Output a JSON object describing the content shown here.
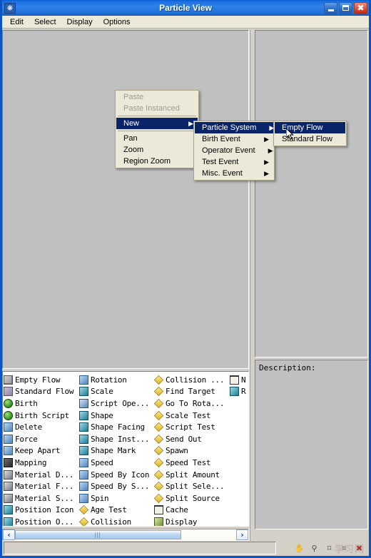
{
  "window": {
    "title": "Particle View",
    "sysicon": "particle-view-icon",
    "buttons": {
      "minimize": "Minimize",
      "maximize": "Maximize",
      "close": "Close"
    }
  },
  "menubar": {
    "items": [
      "Edit",
      "Select",
      "Display",
      "Options"
    ]
  },
  "context_menu": {
    "main": [
      {
        "label": "Paste",
        "disabled": true,
        "submenu": false,
        "selected": false
      },
      {
        "label": "Paste Instanced",
        "disabled": true,
        "submenu": false,
        "selected": false
      },
      {
        "label": "New",
        "disabled": false,
        "submenu": true,
        "selected": true
      },
      {
        "label": "Pan",
        "disabled": false,
        "submenu": false,
        "selected": false
      },
      {
        "label": "Zoom",
        "disabled": false,
        "submenu": false,
        "selected": false
      },
      {
        "label": "Region Zoom",
        "disabled": false,
        "submenu": false,
        "selected": false
      }
    ],
    "new_submenu": [
      {
        "label": "Particle System",
        "submenu": true,
        "selected": true
      },
      {
        "label": "Birth Event",
        "submenu": true,
        "selected": false
      },
      {
        "label": "Operator Event",
        "submenu": true,
        "selected": false
      },
      {
        "label": "Test Event",
        "submenu": true,
        "selected": false
      },
      {
        "label": "Misc. Event",
        "submenu": true,
        "selected": false
      }
    ],
    "particle_system_submenu": [
      {
        "label": "Empty Flow",
        "submenu": false,
        "selected": true
      },
      {
        "label": "Standard Flow",
        "submenu": false,
        "selected": false
      }
    ],
    "arrow_glyph": "▶"
  },
  "depot": {
    "columns": [
      {
        "items": [
          {
            "label": "Empty Flow",
            "icon": "empty-flow-icon",
            "style": "flow"
          },
          {
            "label": "Standard Flow",
            "icon": "standard-flow-icon",
            "style": "flow2"
          },
          {
            "label": "Birth",
            "icon": "birth-icon",
            "style": "green"
          },
          {
            "label": "Birth Script",
            "icon": "birth-script-icon",
            "style": "green"
          },
          {
            "label": "Delete",
            "icon": "delete-icon",
            "style": "blue"
          },
          {
            "label": "Force",
            "icon": "force-icon",
            "style": "blue"
          },
          {
            "label": "Keep Apart",
            "icon": "keep-apart-icon",
            "style": "blue"
          },
          {
            "label": "Mapping",
            "icon": "mapping-icon",
            "style": "dark"
          },
          {
            "label": "Material D...",
            "icon": "material-dynamic-icon",
            "style": "mat"
          },
          {
            "label": "Material F...",
            "icon": "material-frequency-icon",
            "style": "mat"
          },
          {
            "label": "Material S...",
            "icon": "material-static-icon",
            "style": "mat"
          },
          {
            "label": "Position Icon",
            "icon": "position-icon",
            "style": "teal"
          },
          {
            "label": "Position O...",
            "icon": "position-object-icon",
            "style": "teal"
          }
        ]
      },
      {
        "items": [
          {
            "label": "Rotation",
            "icon": "rotation-icon",
            "style": "blue"
          },
          {
            "label": "Scale",
            "icon": "scale-icon",
            "style": "teal"
          },
          {
            "label": "Script Ope...",
            "icon": "script-operator-icon",
            "style": "sq-s"
          },
          {
            "label": "Shape",
            "icon": "shape-icon",
            "style": "teal"
          },
          {
            "label": "Shape Facing",
            "icon": "shape-facing-icon",
            "style": "teal"
          },
          {
            "label": "Shape Inst...",
            "icon": "shape-instance-icon",
            "style": "teal"
          },
          {
            "label": "Shape Mark",
            "icon": "shape-mark-icon",
            "style": "teal"
          },
          {
            "label": "Speed",
            "icon": "speed-icon",
            "style": "blue"
          },
          {
            "label": "Speed By Icon",
            "icon": "speed-by-icon-icon",
            "style": "blue"
          },
          {
            "label": "Speed By S...",
            "icon": "speed-by-surface-icon",
            "style": "blue"
          },
          {
            "label": "Spin",
            "icon": "spin-icon",
            "style": "blue"
          },
          {
            "label": "Age Test",
            "icon": "age-test-icon",
            "style": "diamond"
          },
          {
            "label": "Collision",
            "icon": "collision-icon",
            "style": "diamond"
          }
        ]
      },
      {
        "items": [
          {
            "label": "Collision ...",
            "icon": "collision-spawn-icon",
            "style": "diamond"
          },
          {
            "label": "Find Target",
            "icon": "find-target-icon",
            "style": "diamond"
          },
          {
            "label": "Go To Rota...",
            "icon": "go-to-rotation-icon",
            "style": "diamond"
          },
          {
            "label": "Scale Test",
            "icon": "scale-test-icon",
            "style": "diamond"
          },
          {
            "label": "Script Test",
            "icon": "script-test-icon",
            "style": "diamond"
          },
          {
            "label": "Send Out",
            "icon": "send-out-icon",
            "style": "diamond"
          },
          {
            "label": "Spawn",
            "icon": "spawn-icon",
            "style": "diamond"
          },
          {
            "label": "Speed Test",
            "icon": "speed-test-icon",
            "style": "diamond"
          },
          {
            "label": "Split Amount",
            "icon": "split-amount-icon",
            "style": "diamond"
          },
          {
            "label": "Split Sele...",
            "icon": "split-selected-icon",
            "style": "diamond"
          },
          {
            "label": "Split Source",
            "icon": "split-source-icon",
            "style": "diamond"
          },
          {
            "label": "Cache",
            "icon": "cache-icon",
            "style": "cache"
          },
          {
            "label": "Display",
            "icon": "display-icon",
            "style": "display"
          }
        ]
      },
      {
        "items": [
          {
            "label": "N",
            "icon": "notes-icon",
            "style": "cache"
          },
          {
            "label": "R",
            "icon": "render-icon",
            "style": "teal"
          }
        ]
      }
    ]
  },
  "description_panel": {
    "label": "Description:"
  },
  "scrollbar": {
    "left_arrow": "‹",
    "right_arrow": "›",
    "grip": "grip-handle"
  },
  "statusbar": {
    "tools": [
      {
        "name": "pan-tool",
        "glyph": "✋"
      },
      {
        "name": "zoom-tool",
        "glyph": "⚲"
      },
      {
        "name": "region-zoom-tool",
        "glyph": "⌑"
      },
      {
        "name": "zoom-extents-tool",
        "glyph": "⌗"
      },
      {
        "name": "close-tool",
        "glyph": "✖"
      }
    ],
    "watermark": "学习网"
  }
}
